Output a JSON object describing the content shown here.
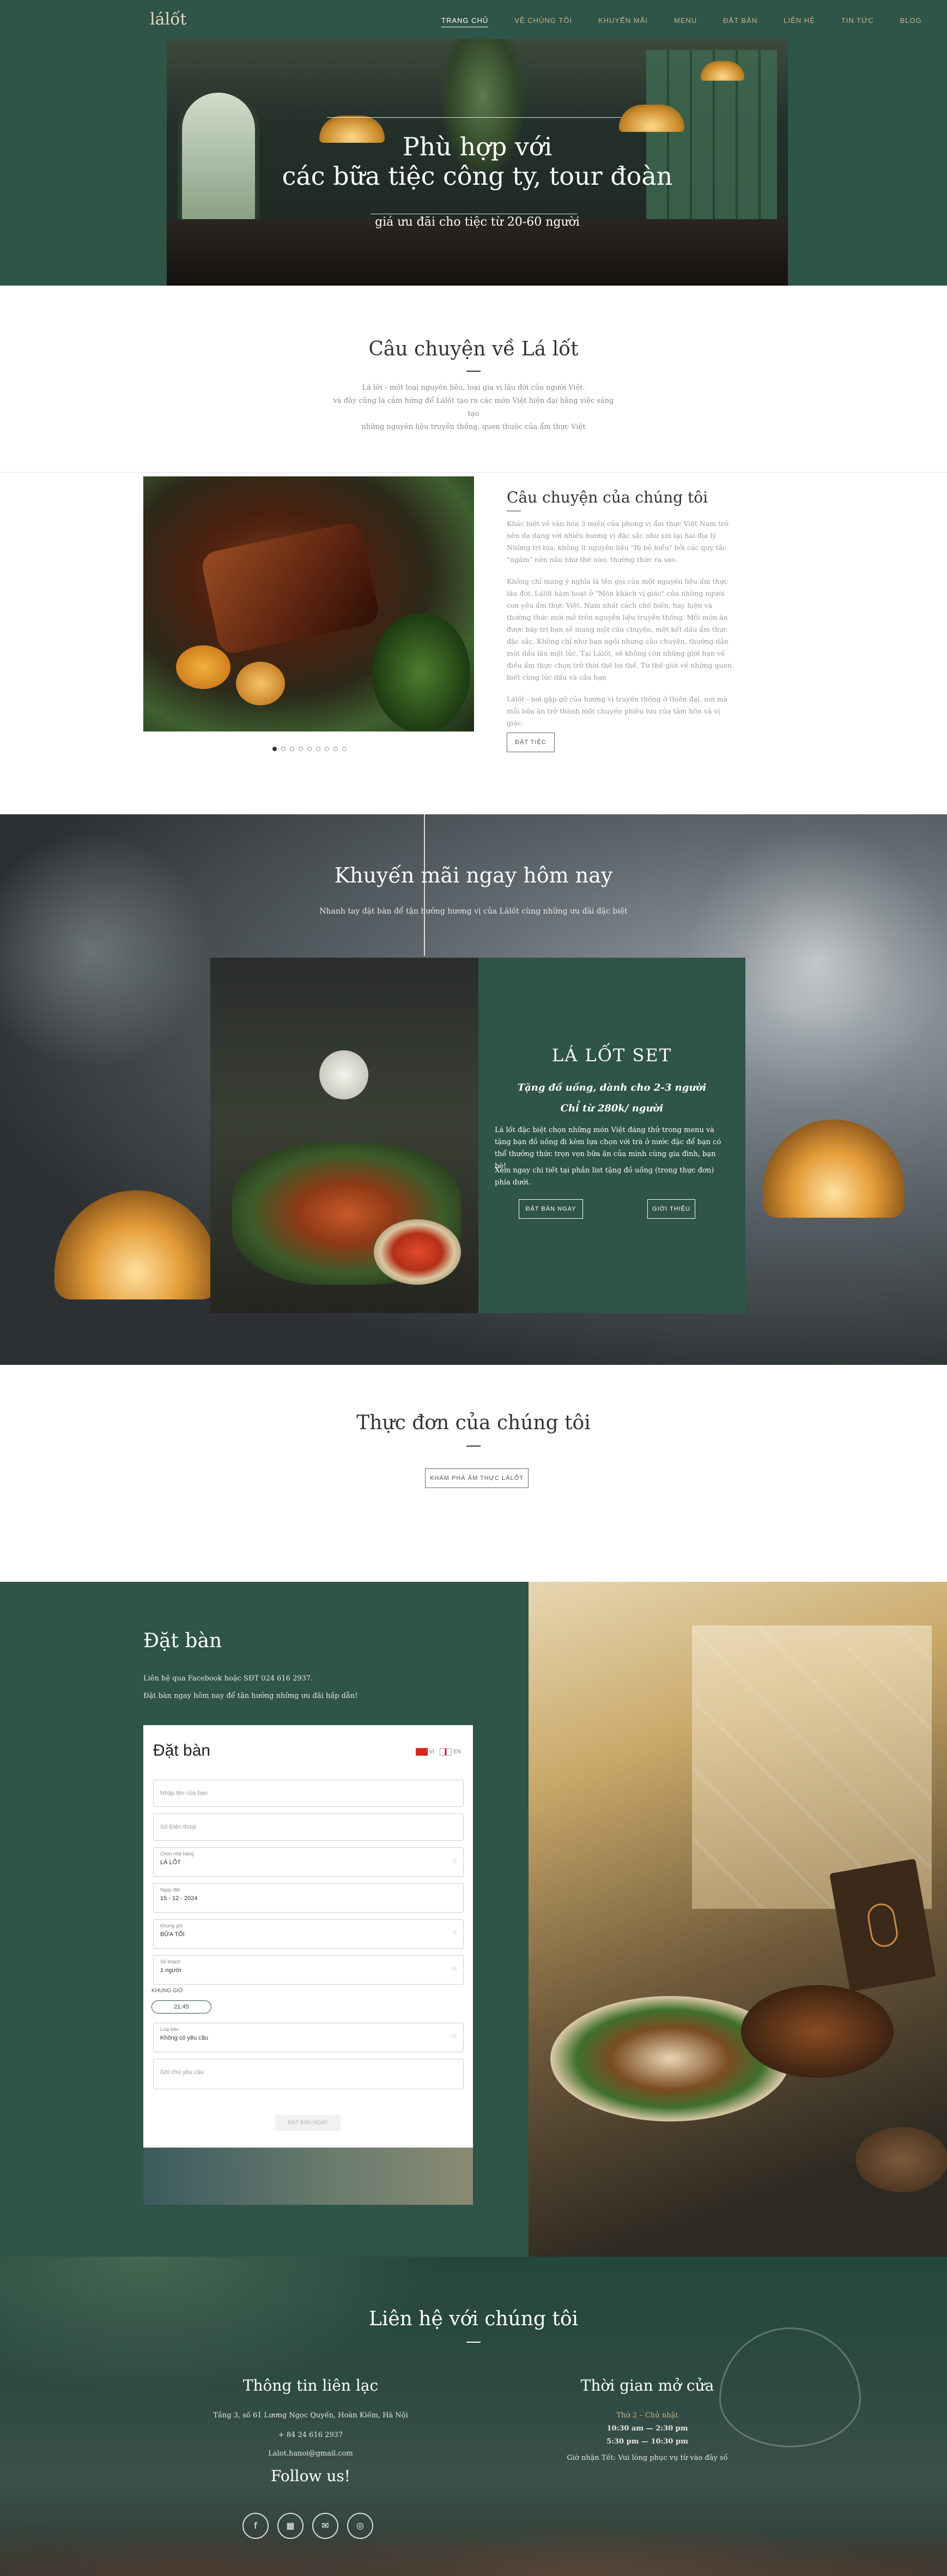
{
  "nav": {
    "logo": "lálốt",
    "items": [
      "TRANG CHỦ",
      "VỀ CHÚNG TÔI",
      "KHUYẾN MÃI",
      "MENU",
      "ĐẶT BÀN",
      "LIÊN HỆ",
      "TIN TỨC",
      "BLOG"
    ],
    "active_index": 0
  },
  "hero": {
    "title_line1": "Phù hợp với",
    "title_line2": "các bữa tiệc công ty, tour đoàn",
    "subtitle": "giá ưu đãi cho tiệc từ 20-60 người"
  },
  "story": {
    "title": "Câu chuyện về Lá lốt",
    "text_line1": "Lá lốt - một loại nguyên liệu, loại gia vị lâu đời của người Việt.",
    "text_line2": "và đây cũng là cảm hứng để Lálốt tạo ra các món Việt hiện đại bằng việc sáng tạo",
    "text_line3": "những nguyên liệu truyền thống, quen thuộc của ẩm thực Việt"
  },
  "our_story": {
    "title": "Câu chuyện của chúng tôi",
    "p1": "Khác biệt về văn hóa 3 miền của phong vị ẩm thực Việt Nam trở nên đa dạng với nhiều hương vị đặc sắc như xin tại hai địa lý. Những tri bia, không ít nguyên liệu \"Bị bỏ hiểu\" bởi các quy tắc \"ngầm\" nên nấu như thế nào, thường thức ra sao.",
    "p2": "Không chỉ mang ý nghĩa là tên gọi của một nguyên liệu ẩm thực lâu đời, Lálốt hàm hoạt ở \"Món khách vị giác\" của những người con yêu ẩm thực Việt. Nam nhất cách chế biến, hay hiện và thường thức mới mẻ trên nguyên liệu truyền thống. Mỗi món ăn được bày trí bạn sẽ mang một câu chuyện, một kết dấu ẩm thực đặc sắc. Không chỉ như bạn ngồi nhưng câu chuyện, thưởng dân một dấu lâu một lúc. Tại Lálốt, sẽ không còn những giới hạn về điều ẩm thực chọn trở thời thế lợi thể. Từ thế giới về những quen biết cùng lúc dấu và câu bạn",
    "p3": "Lálốt - nơi gặp gỡ của hương vị truyền thống ở thiên đại, nơi mà mỗi bữa ăn trở thành một chuyến phiêu lưu của tâm hồn và vị giác.",
    "button": "ĐẶT TIỆC",
    "dots_count": 9
  },
  "promo": {
    "title": "Khuyến mãi ngay hôm nay",
    "subtitle": "Nhanh tay đặt bàn để tận hưởng hương vị của Lálốt cùng những ưu đãi đặc biệt",
    "card_title": "LÁ LỐT SET",
    "card_line1": "Tặng đồ uống, dành cho 2-3 người",
    "card_line2": "Chỉ từ 280k/ người",
    "card_p1": "Lá lốt đặc biệt chọn những món Việt đáng thử trong menu và tặng bạn đồ uống đi kèm lựa chọn với trà ở nước đặc để bạn có thể thưởng thức trọn vẹn bữa ăn của mình cùng gia đình, bạn bè!",
    "card_p2": "Xem ngay chi tiết tại phần list tặng đồ uống (trong thực đơn) phía dưới.",
    "btn_book": "ĐẶT BÀN NGAY",
    "btn_intro": "GIỚI THIỆU"
  },
  "menu": {
    "title": "Thực đơn của chúng tôi",
    "button": "KHÁM PHÁ ẨM THỰC LÁLỐT"
  },
  "booking": {
    "title": "Đặt bàn",
    "note1": "Liên hệ qua Facebook hoặc SĐT 024 616 2937.",
    "note2": "Đặt bàn ngay hôm nay để tận hưởng những ưu đãi hấp dẫn!",
    "form_title": "Đặt bàn",
    "lang_vi": "VI",
    "lang_en": "EN",
    "name_placeholder": "Nhập tên của bạn",
    "phone_placeholder": "Số Điện thoại",
    "restaurant_label": "Chọn nhà hàng",
    "restaurant_value": "LÁ LỐT",
    "date_label": "Ngày đặt",
    "date_value": "15 - 12 - 2024",
    "meal_label": "Khung giờ",
    "meal_value": "BỮA TỐI",
    "guests_label": "Số khách",
    "guests_value": "1 người",
    "time_label": "KHUNG GIỜ",
    "time_value": "21:45",
    "request_label": "Loại bàn",
    "request_value": "Không có yêu cầu",
    "note_placeholder": "Ghi chú yêu cầu",
    "submit": "ĐẶT BÀN NGAY"
  },
  "contact": {
    "title": "Liên hệ với chúng tôi",
    "info_title": "Thông tin liên lạc",
    "address": "Tầng 3, số 61 Lương Ngọc Quyến, Hoàn Kiếm, Hà Nội",
    "phone": "+ 84 24 616 2937",
    "email": "Lalot.hanoi@gmail.com",
    "hours_title": "Thời gian mở cửa",
    "days": "Thứ 2 – Chủ nhật",
    "hours1": "10:30 am — 2:30 pm",
    "hours2": "5:30 pm — 10:30 pm",
    "hours_note": "Giờ nhận Tết: Vui lòng phục vụ từ vào đây số",
    "follow": "Follow us!",
    "socials": [
      "f",
      "▦",
      "✉",
      "◎"
    ]
  }
}
